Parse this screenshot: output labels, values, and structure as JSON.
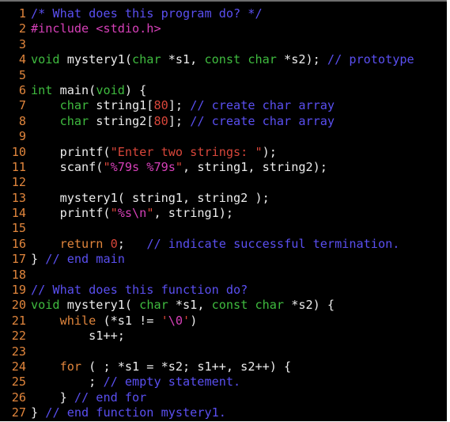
{
  "title": "What does this program do?",
  "colors": {
    "background": "#000000",
    "line_number": "#e0853c",
    "plain": "#ececec",
    "comment": "#5a4ff0",
    "preprocessor": "#d640b8",
    "type": "#3fbb3f",
    "keyword": "#e0853c",
    "string": "#d8463a",
    "format": "#d640b8"
  },
  "lines": [
    {
      "n": "1",
      "tokens": [
        {
          "c": "comment",
          "t": "/* What does this program do? */"
        }
      ]
    },
    {
      "n": "2",
      "tokens": [
        {
          "c": "pre",
          "t": "#include <stdio.h>"
        }
      ]
    },
    {
      "n": "3",
      "tokens": []
    },
    {
      "n": "4",
      "tokens": [
        {
          "c": "type",
          "t": "void"
        },
        {
          "c": "plain",
          "t": " mystery1("
        },
        {
          "c": "type",
          "t": "char"
        },
        {
          "c": "plain",
          "t": " *s1, "
        },
        {
          "c": "type",
          "t": "const char"
        },
        {
          "c": "plain",
          "t": " *s2); "
        },
        {
          "c": "comment",
          "t": "// prototype"
        }
      ]
    },
    {
      "n": "5",
      "tokens": []
    },
    {
      "n": "6",
      "tokens": [
        {
          "c": "type",
          "t": "int"
        },
        {
          "c": "plain",
          "t": " main("
        },
        {
          "c": "type",
          "t": "void"
        },
        {
          "c": "plain",
          "t": ") {"
        }
      ]
    },
    {
      "n": "7",
      "tokens": [
        {
          "c": "plain",
          "t": "    "
        },
        {
          "c": "type",
          "t": "char"
        },
        {
          "c": "plain",
          "t": " string1["
        },
        {
          "c": "num",
          "t": "80"
        },
        {
          "c": "plain",
          "t": "]; "
        },
        {
          "c": "comment",
          "t": "// create char array"
        }
      ]
    },
    {
      "n": "8",
      "tokens": [
        {
          "c": "plain",
          "t": "    "
        },
        {
          "c": "type",
          "t": "char"
        },
        {
          "c": "plain",
          "t": " string2["
        },
        {
          "c": "num",
          "t": "80"
        },
        {
          "c": "plain",
          "t": "]; "
        },
        {
          "c": "comment",
          "t": "// create char array"
        }
      ]
    },
    {
      "n": "9",
      "tokens": []
    },
    {
      "n": "10",
      "tokens": [
        {
          "c": "plain",
          "t": "    printf("
        },
        {
          "c": "str",
          "t": "\"Enter two strings: \""
        },
        {
          "c": "plain",
          "t": ");"
        }
      ]
    },
    {
      "n": "11",
      "tokens": [
        {
          "c": "plain",
          "t": "    scanf("
        },
        {
          "c": "str",
          "t": "\""
        },
        {
          "c": "fmt",
          "t": "%79s %79s"
        },
        {
          "c": "str",
          "t": "\""
        },
        {
          "c": "plain",
          "t": ", string1, string2);"
        }
      ]
    },
    {
      "n": "12",
      "tokens": []
    },
    {
      "n": "13",
      "tokens": [
        {
          "c": "plain",
          "t": "    mystery1( string1, string2 );"
        }
      ]
    },
    {
      "n": "14",
      "tokens": [
        {
          "c": "plain",
          "t": "    printf("
        },
        {
          "c": "str",
          "t": "\""
        },
        {
          "c": "fmt",
          "t": "%s\\n"
        },
        {
          "c": "str",
          "t": "\""
        },
        {
          "c": "plain",
          "t": ", string1);"
        }
      ]
    },
    {
      "n": "15",
      "tokens": []
    },
    {
      "n": "16",
      "tokens": [
        {
          "c": "plain",
          "t": "    "
        },
        {
          "c": "kw",
          "t": "return"
        },
        {
          "c": "plain",
          "t": " "
        },
        {
          "c": "num",
          "t": "0"
        },
        {
          "c": "plain",
          "t": ";   "
        },
        {
          "c": "comment",
          "t": "// indicate successful termination."
        }
      ]
    },
    {
      "n": "17",
      "tokens": [
        {
          "c": "plain",
          "t": "} "
        },
        {
          "c": "comment",
          "t": "// end main"
        }
      ]
    },
    {
      "n": "18",
      "tokens": []
    },
    {
      "n": "19",
      "tokens": [
        {
          "c": "comment",
          "t": "// What does this function do?"
        }
      ]
    },
    {
      "n": "20",
      "tokens": [
        {
          "c": "type",
          "t": "void"
        },
        {
          "c": "plain",
          "t": " mystery1( "
        },
        {
          "c": "type",
          "t": "char"
        },
        {
          "c": "plain",
          "t": " *s1, "
        },
        {
          "c": "type",
          "t": "const char"
        },
        {
          "c": "plain",
          "t": " *s2) {"
        }
      ]
    },
    {
      "n": "21",
      "tokens": [
        {
          "c": "plain",
          "t": "    "
        },
        {
          "c": "kw",
          "t": "while"
        },
        {
          "c": "plain",
          "t": " (*s1 != "
        },
        {
          "c": "str",
          "t": "'"
        },
        {
          "c": "fmt",
          "t": "\\0"
        },
        {
          "c": "str",
          "t": "'"
        },
        {
          "c": "plain",
          "t": ")"
        }
      ]
    },
    {
      "n": "22",
      "tokens": [
        {
          "c": "plain",
          "t": "        s1++;"
        }
      ]
    },
    {
      "n": "23",
      "tokens": []
    },
    {
      "n": "24",
      "tokens": [
        {
          "c": "plain",
          "t": "    "
        },
        {
          "c": "kw",
          "t": "for"
        },
        {
          "c": "plain",
          "t": " ( ; *s1 = *s2; s1++, s2++) {"
        }
      ]
    },
    {
      "n": "25",
      "tokens": [
        {
          "c": "plain",
          "t": "        ; "
        },
        {
          "c": "comment",
          "t": "// empty statement."
        }
      ]
    },
    {
      "n": "26",
      "tokens": [
        {
          "c": "plain",
          "t": "    } "
        },
        {
          "c": "comment",
          "t": "// end for"
        }
      ]
    },
    {
      "n": "27",
      "tokens": [
        {
          "c": "plain",
          "t": "} "
        },
        {
          "c": "comment",
          "t": "// end function mystery1."
        }
      ]
    }
  ]
}
